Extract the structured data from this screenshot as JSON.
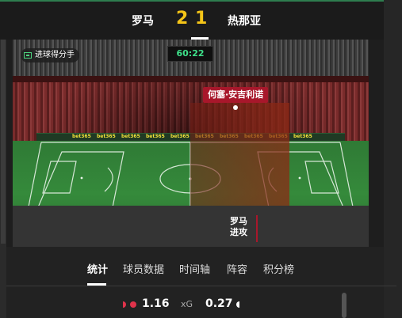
{
  "header": {
    "home_team": "罗马",
    "away_team": "热那亚",
    "home_score": "2",
    "away_score": "1"
  },
  "stage": {
    "goalscorer_badge": "进球得分手",
    "match_clock": "60:22",
    "player_tag": "何塞·安吉利诺",
    "ad_text": "bet365",
    "possession_team": "罗马",
    "possession_state": "进攻"
  },
  "tabs": [
    {
      "label": "统计",
      "active": true
    },
    {
      "label": "球员数据",
      "active": false
    },
    {
      "label": "时间轴",
      "active": false
    },
    {
      "label": "阵容",
      "active": false
    },
    {
      "label": "积分榜",
      "active": false
    }
  ],
  "stats": {
    "home_value": "1.16",
    "label": "xG",
    "away_value": "0.27",
    "home_color": "#e0334b",
    "away_color": "#ffffff"
  },
  "colors": {
    "score": "#f5c518",
    "clock": "#3ee08a",
    "accent_red": "#a8172b"
  }
}
